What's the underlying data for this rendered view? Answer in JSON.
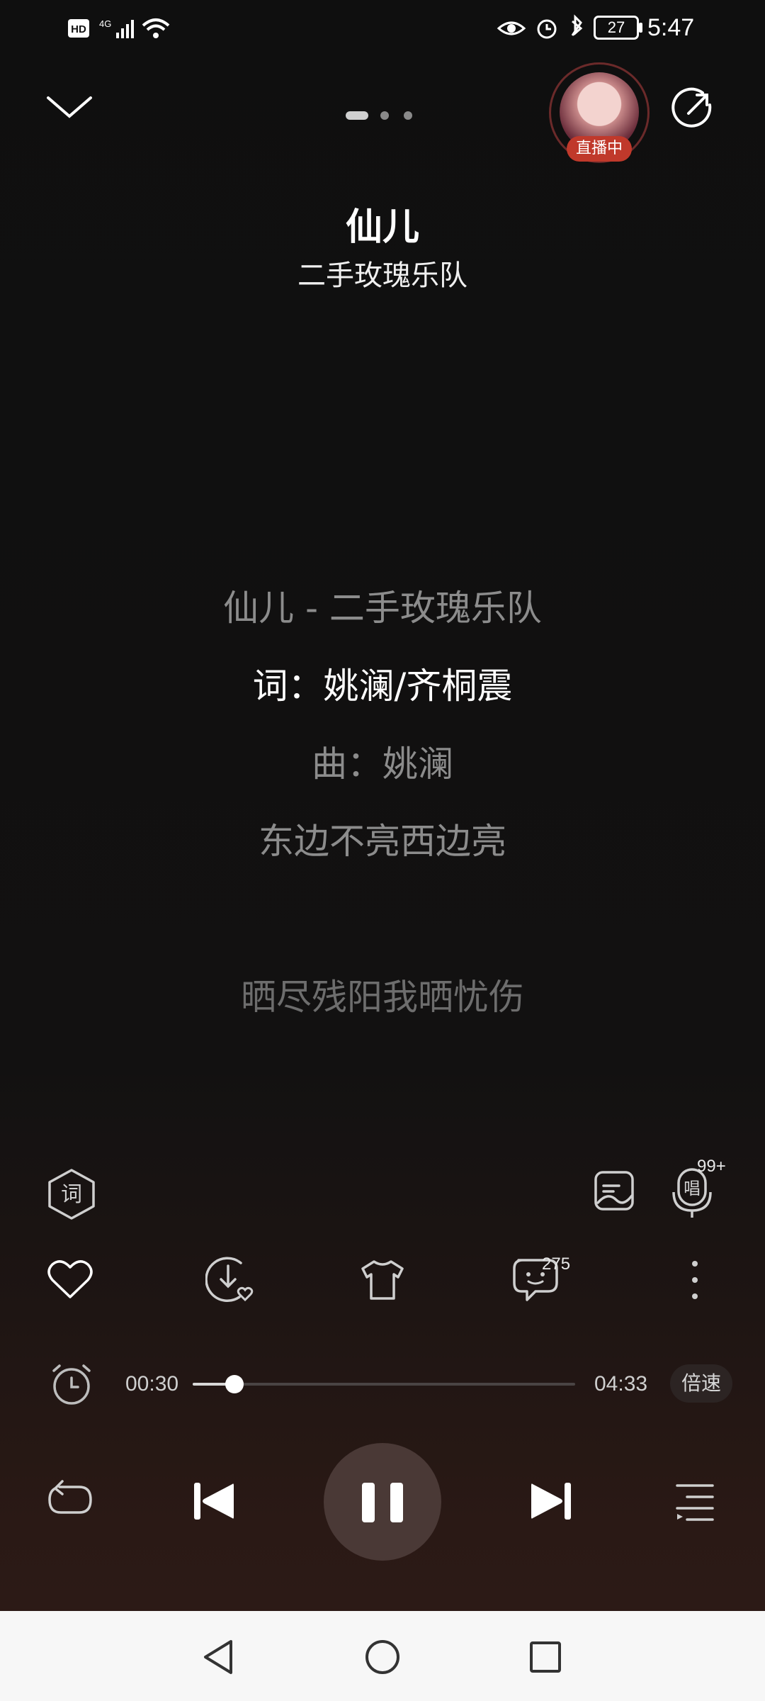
{
  "status_bar": {
    "hd": "HD",
    "network": "4G",
    "battery": "27",
    "time": "5:47"
  },
  "header": {
    "pager_dots": 3,
    "live_label": "直播中"
  },
  "song": {
    "title": "仙儿",
    "artist": "二手玫瑰乐队"
  },
  "lyrics": [
    "仙儿 - 二手玫瑰乐队",
    "词：姚澜/齐桐震",
    "曲：姚澜",
    "东边不亮西边亮",
    "晒尽残阳我晒忧伤"
  ],
  "tools": {
    "lyric_icon_label": "词",
    "sing_icon_label": "唱",
    "sing_count": "99+",
    "comment_count": "275"
  },
  "progress": {
    "elapsed": "00:30",
    "total": "04:33",
    "fraction": 0.11,
    "speed_label": "倍速"
  },
  "colors": {
    "live_badge": "#c0392b",
    "play_button_bg": "#4a3936",
    "nav_bar": "#f7f7f7"
  }
}
